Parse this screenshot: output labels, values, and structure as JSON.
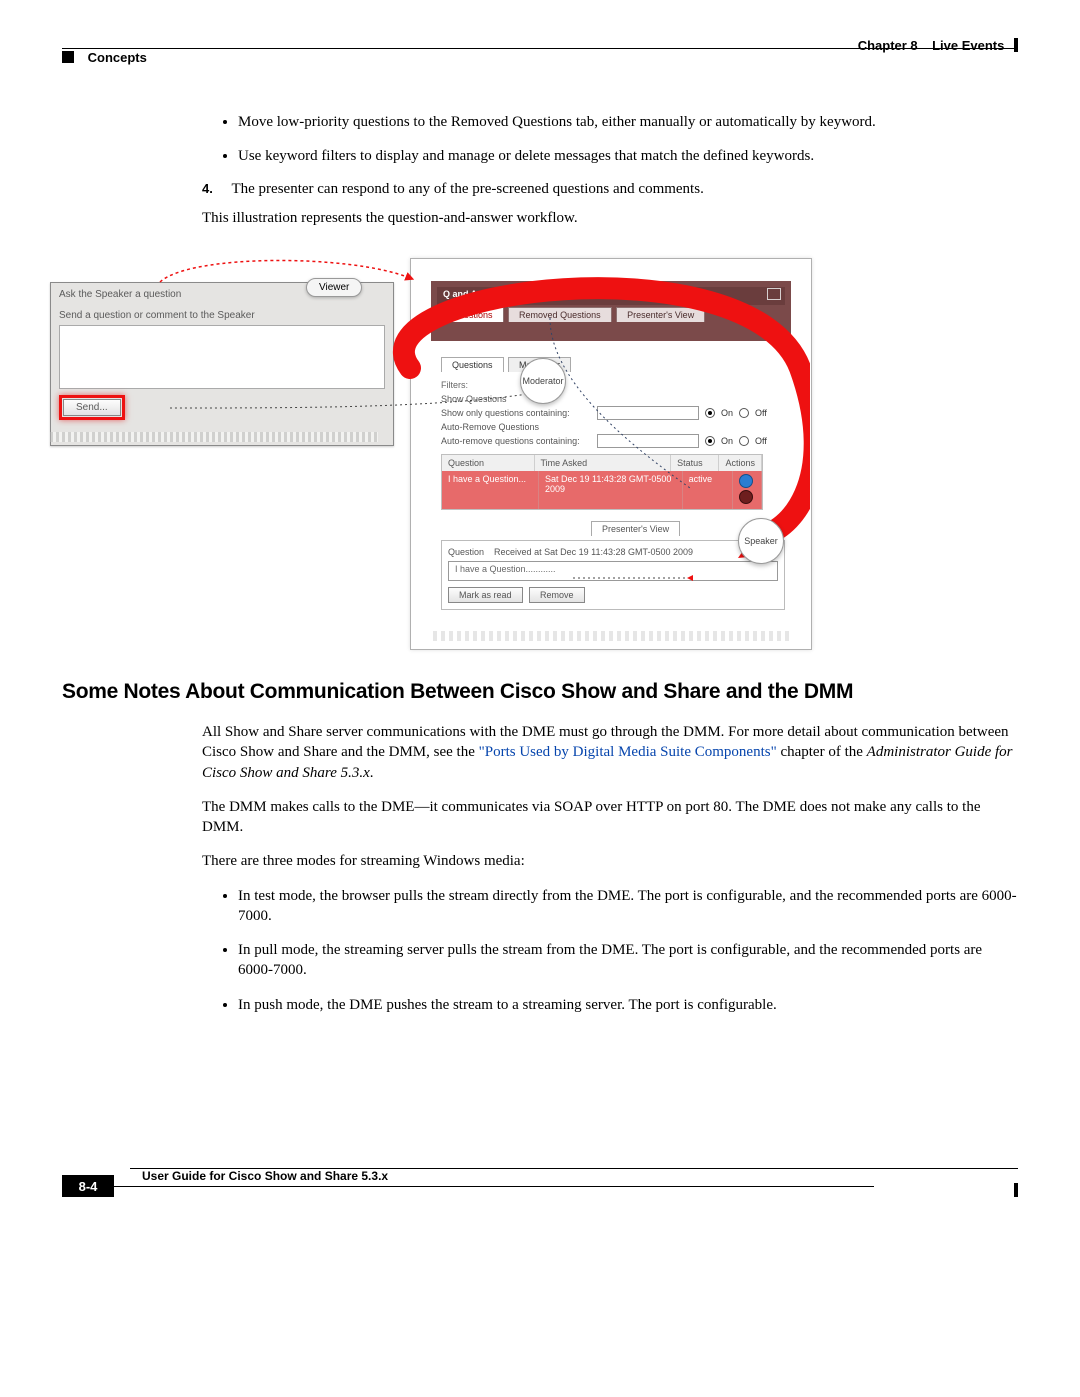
{
  "header": {
    "left_label": "Concepts",
    "right_chapter": "Chapter 8",
    "right_title": "Live Events"
  },
  "body": {
    "bullets_top": [
      "Move low-priority questions to the Removed Questions tab, either manually or automatically by keyword.",
      "Use keyword filters to display and manage or delete messages that match the defined keywords."
    ],
    "step4_num": "4.",
    "step4_text": "The presenter can respond to any of the pre-screened questions and comments.",
    "illustration_intro": "This illustration represents the question-and-answer workflow."
  },
  "figure": {
    "viewer_badge": "Viewer",
    "moderator_badge": "Moderator",
    "speaker_badge": "Speaker",
    "viewer": {
      "ask_label": "Ask the Speaker a question",
      "send_label": "Send a question or comment to the Speaker",
      "send_btn": "Send..."
    },
    "module": {
      "title": "Q and A module",
      "tabs": {
        "t1": "Questions",
        "t2": "Removed Questions",
        "t3": "Presenter's View"
      },
      "subtabs": {
        "s1": "Questions",
        "s2": "Moderator"
      },
      "filters_label": "Filters:",
      "show_q": "Show Questions",
      "show_only_label": "Show only questions containing:",
      "auto_remove": "Auto-Remove Questions",
      "auto_remove_label": "Auto-remove questions containing:",
      "on": "On",
      "off": "Off",
      "col_q": "Question",
      "col_time": "Time Asked",
      "col_status": "Status",
      "col_actions": "Actions",
      "row_q": "I have a Question...",
      "row_time": "Sat Dec 19 11:43:28 GMT-0500 2009",
      "row_status": "active"
    },
    "presenter": {
      "tab": "Presenter's View",
      "label": "Question",
      "received": "Received at Sat Dec 19 11:43:28 GMT-0500 2009",
      "text": "I have a Question............",
      "btn_mark": "Mark as read",
      "btn_remove": "Remove"
    }
  },
  "section": {
    "heading": "Some Notes About Communication Between Cisco Show and Share and the DMM",
    "para1_a": "All Show and Share server communications with the DME must go through the DMM. For more detail about communication between Cisco Show and Share and the DMM, see the ",
    "para1_link": "\"Ports Used by Digital Media Suite Components\"",
    "para1_b": " chapter of the ",
    "para1_ital": "Administrator Guide for Cisco Show and Share 5.3.x",
    "para1_c": ".",
    "para2": "The DMM makes calls to the DME—it communicates via SOAP over HTTP on port 80. The DME does not make any calls to the DMM.",
    "para3": "There are three modes for streaming Windows media:",
    "bullets": [
      "In test mode, the browser pulls the stream directly from the DME. The port is configurable, and the recommended ports are 6000-7000.",
      "In pull mode, the streaming server pulls the stream from the DME. The port is configurable, and the recommended ports are 6000-7000.",
      "In push mode, the DME pushes the stream to a streaming server. The port is configurable."
    ]
  },
  "footer": {
    "guide_title": "User Guide for Cisco Show and Share 5.3.x",
    "page_number": "8-4"
  }
}
